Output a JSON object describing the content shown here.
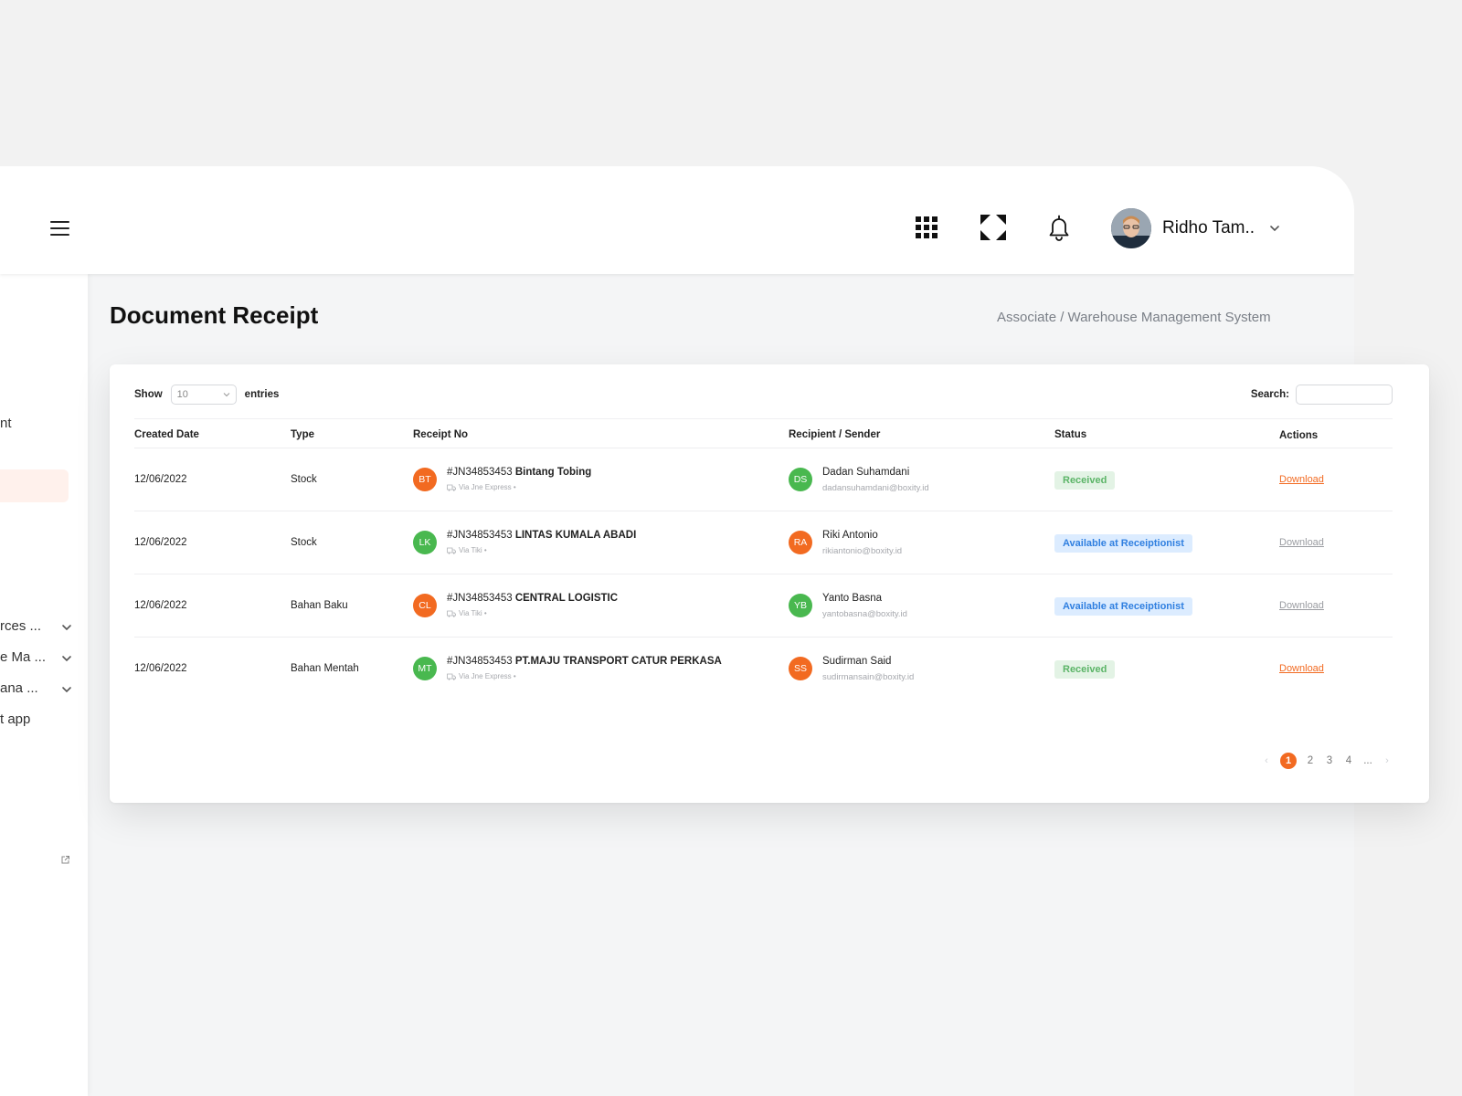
{
  "header": {
    "user_name": "Ridho Tam.."
  },
  "sidebar": {
    "items": [
      {
        "label": "nt",
        "has_chevron": false
      },
      {
        "label": "rces ...",
        "has_chevron": true
      },
      {
        "label": "e Ma ...",
        "has_chevron": true
      },
      {
        "label": "ana ...",
        "has_chevron": true
      },
      {
        "label": "t app",
        "has_chevron": false
      }
    ]
  },
  "page": {
    "title": "Document Receipt",
    "breadcrumb": "Associate / Warehouse Management System"
  },
  "table_controls": {
    "show_label": "Show",
    "entries_value": "10",
    "entries_label": "entries",
    "search_label": "Search:",
    "search_value": ""
  },
  "table": {
    "headers": [
      "Created Date",
      "Type",
      "Receipt No",
      "Recipient / Sender",
      "Status",
      "Actions"
    ],
    "rows": [
      {
        "date": "12/06/2022",
        "type": "Stock",
        "receipt_initials": "BT",
        "receipt_color": "#f26a21",
        "receipt_no": "#JN34853453",
        "receipt_name": "Bintang Tobing",
        "courier": "Via Jne Express •",
        "sender_initials": "DS",
        "sender_color": "#49b84f",
        "sender_name": "Dadan Suhamdani",
        "sender_email": "dadansuhamdani@boxity.id",
        "status": "Received",
        "status_kind": "received",
        "action": "Download",
        "action_enabled": true
      },
      {
        "date": "12/06/2022",
        "type": "Stock",
        "receipt_initials": "LK",
        "receipt_color": "#49b84f",
        "receipt_no": "#JN34853453",
        "receipt_name": "LINTAS KUMALA ABADI",
        "courier": "Via Tiki •",
        "sender_initials": "RA",
        "sender_color": "#f26a21",
        "sender_name": "Riki Antonio",
        "sender_email": "rikiantonio@boxity.id",
        "status": "Available at Receiptionist",
        "status_kind": "available",
        "action": "Download",
        "action_enabled": false
      },
      {
        "date": "12/06/2022",
        "type": "Bahan Baku",
        "receipt_initials": "CL",
        "receipt_color": "#f26a21",
        "receipt_no": "#JN34853453",
        "receipt_name": " CENTRAL LOGISTIC",
        "courier": "Via Tiki •",
        "sender_initials": "YB",
        "sender_color": "#49b84f",
        "sender_name": "Yanto Basna",
        "sender_email": "yantobasna@boxity.id",
        "status": "Available at Receiptionist",
        "status_kind": "available",
        "action": "Download",
        "action_enabled": false
      },
      {
        "date": "12/06/2022",
        "type": "Bahan Mentah",
        "receipt_initials": "MT",
        "receipt_color": "#49b84f",
        "receipt_no": "#JN34853453",
        "receipt_name": "PT.MAJU TRANSPORT CATUR PERKASA",
        "courier": "Via Jne Express •",
        "sender_initials": "SS",
        "sender_color": "#f26a21",
        "sender_name": "Sudirman Said",
        "sender_email": "sudirmansain@boxity.id",
        "status": "Received",
        "status_kind": "received",
        "action": "Download",
        "action_enabled": true
      }
    ]
  },
  "pagination": {
    "prev": "‹",
    "pages": [
      "1",
      "2",
      "3",
      "4",
      "..."
    ],
    "active": "1",
    "next": "›"
  },
  "colors": {
    "accent": "#f26a21",
    "success": "#49b84f",
    "info": "#2f7fe0"
  },
  "icons": {
    "menu": "hamburger-icon",
    "apps": "apps-grid-icon",
    "fullscreen": "expand-icon",
    "notifications": "bell-icon",
    "external": "external-link-icon",
    "courier": "truck-icon"
  }
}
